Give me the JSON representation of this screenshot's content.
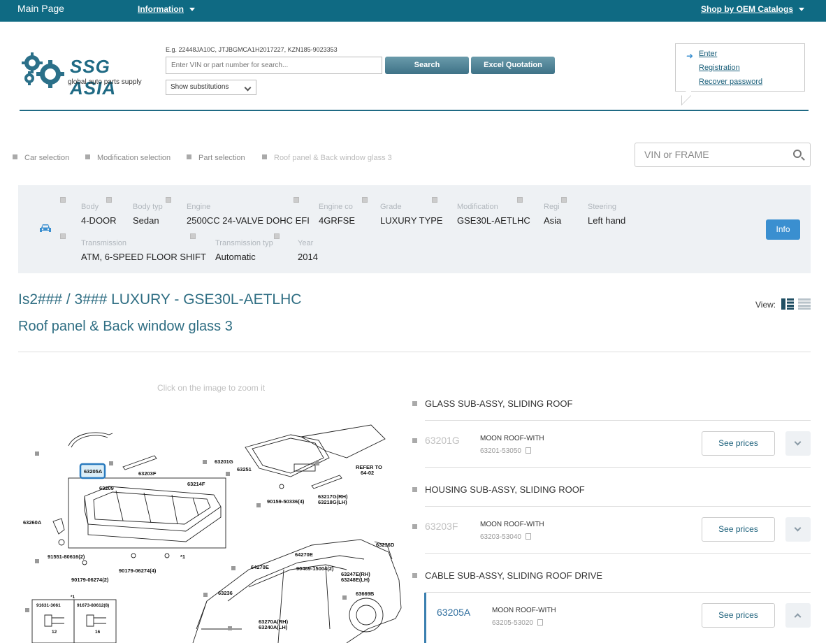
{
  "topbar": {
    "main": "Main Page",
    "information": "Information",
    "shop": "Shop by OEM Catalogs"
  },
  "logo": {
    "brand": "SSG ASIA",
    "tagline": "global auto parts supply"
  },
  "search": {
    "example": "E.g. 22448JA10C, JTJBGMCA1H2017227, KZN185-9023353",
    "placeholder": "Enter VIN or part number for search...",
    "search_label": "Search",
    "excel_label": "Excel Quotation",
    "substitutions": "Show substitutions"
  },
  "login": {
    "enter": "Enter",
    "registration": "Registration",
    "recover": "Recover password"
  },
  "breadcrumbs": [
    "Car selection",
    "Modification selection",
    "Part selection",
    "Roof panel & Back window glass 3"
  ],
  "vin_search": {
    "placeholder": "VIN or FRAME"
  },
  "car": {
    "fields": [
      {
        "label": "Body",
        "value": "4-DOOR"
      },
      {
        "label": "Body typ",
        "value": "Sedan"
      },
      {
        "label": "Engine",
        "value": "2500CC 24-VALVE DOHC EFI"
      },
      {
        "label": "Engine co",
        "value": "4GRFSE"
      },
      {
        "label": "Grade",
        "value": "LUXURY TYPE"
      },
      {
        "label": "Modification",
        "value": "GSE30L-AETLHC"
      },
      {
        "label": "Regi",
        "value": "Asia"
      },
      {
        "label": "Steering",
        "value": "Left hand"
      },
      {
        "label": "Transmission",
        "value": "ATM, 6-SPEED FLOOR SHIFT"
      },
      {
        "label": "Transmission typ",
        "value": "Automatic"
      },
      {
        "label": "Year",
        "value": "2014"
      }
    ],
    "info_label": "Info"
  },
  "titles": {
    "model": "Is2### / 3### LUXURY - GSE30L-AETLHC",
    "section": "Roof panel & Back window glass 3",
    "view": "View:"
  },
  "zoom_hint": "Click on the image to zoom it",
  "diagram_labels": [
    "63205A",
    "63203F",
    "63209",
    "63214F",
    "63260A",
    "91551-80616(2)",
    "90179-06274(2)",
    "90179-06274(4)",
    "63201G",
    "63251",
    "90159-50336(4)",
    "63217G(RH)",
    "63218G(LH)",
    "REFER TO",
    "64-02",
    "63236D",
    "64270E",
    "90469-15004(2)",
    "63247E(RH)",
    "63248E(LH)",
    "63236",
    "63669B",
    "63270A(RH)",
    "63240A(LH)",
    "91631-3061",
    "91673-80612(8)",
    "12",
    "16",
    "*1"
  ],
  "parts": [
    {
      "group": "GLASS SUB-ASSY, SLIDING ROOF",
      "code": "63201G",
      "desc": "MOON ROOF-WITH",
      "number": "63201-53050",
      "see_label": "See prices"
    },
    {
      "group": "HOUSING SUB-ASSY, SLIDING ROOF",
      "code": "63203F",
      "desc": "MOON ROOF-WITH",
      "number": "63203-53040",
      "see_label": "See prices"
    },
    {
      "group": "CABLE SUB-ASSY, SLIDING ROOF DRIVE",
      "code": "63205A",
      "desc": "MOON ROOF-WITH",
      "number": "63205-53020",
      "see_label": "See prices"
    }
  ]
}
